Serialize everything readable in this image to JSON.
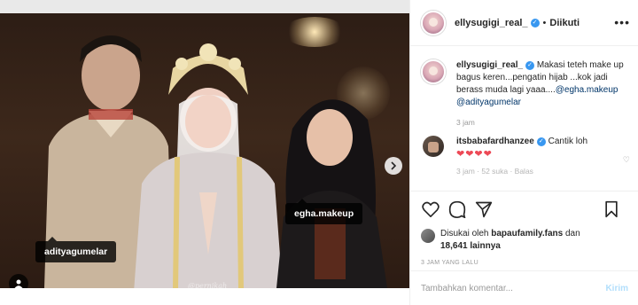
{
  "post": {
    "username": "ellysugigi_real_",
    "follow_status": "Diikuti",
    "more_icon": "more-options-icon",
    "photo_tags": [
      "adityagumelar",
      "egha.makeup"
    ],
    "watermark": "@pernikah"
  },
  "caption": {
    "username": "ellysugigi_real_",
    "text": "Makasi teteh make up bagus keren...pengatin hijab ...kok jadi berass muda lagi yaaa....",
    "mention1": "@egha.makeup",
    "mention2": "@adityagumelar",
    "time": "3 jam"
  },
  "comment": {
    "username": "itsbabafardhanzee",
    "text": "Cantik loh",
    "hearts": "❤❤❤❤",
    "meta_cut": "3 jam · 52 suka · Balas"
  },
  "likes": {
    "prefix": "Disukai oleh",
    "user": "bapaufamily.fans",
    "connector": "dan",
    "count": "18,641 lainnya"
  },
  "timestamp": "3 JAM YANG LALU",
  "add_comment": {
    "placeholder": "Tambahkan komentar...",
    "post_label": "Kirim"
  },
  "colors": {
    "accent": "#3897f0",
    "heart": "#ed4956",
    "link": "#003569",
    "muted": "#999999"
  }
}
